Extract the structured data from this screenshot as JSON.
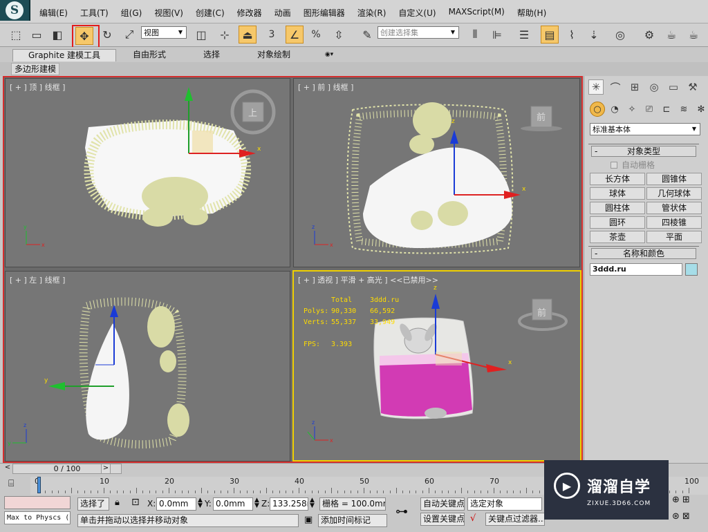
{
  "menubar": {
    "items": [
      "编辑(E)",
      "工具(T)",
      "组(G)",
      "视图(V)",
      "创建(C)",
      "修改器",
      "动画",
      "图形编辑器",
      "渲染(R)",
      "自定义(U)",
      "MAXScript(M)",
      "帮助(H)"
    ]
  },
  "toolbar": {
    "view_dropdown": "视图",
    "selection_set_placeholder": "创建选择集",
    "num_snap": "3",
    "percent": "%"
  },
  "ribbon": {
    "tabs": [
      "Graphite 建模工具",
      "自由形式",
      "选择",
      "对象绘制"
    ],
    "subtab": "多边形建模"
  },
  "viewports": {
    "top": {
      "label": "[ + ] 顶 ] 线框 ]",
      "cube": "上"
    },
    "front": {
      "label": "[ + ] 前 ] 线框 ]",
      "cube": "前"
    },
    "left": {
      "label": "[ + ] 左 ] 线框 ]"
    },
    "persp": {
      "label": "[ + ] 透视 ] 平滑 + 高光 ] <<已禁用>>",
      "cube": "前",
      "stats": {
        "header_total": "Total",
        "header_obj": "3ddd.ru",
        "polys_label": "Polys:",
        "polys_total": "90,330",
        "polys_obj": "66,592",
        "verts_label": "Verts:",
        "verts_total": "55,337",
        "verts_obj": "33,949",
        "fps_label": "FPS:",
        "fps_value": "3.393"
      }
    }
  },
  "command_panel": {
    "category_dropdown": "标准基本体",
    "object_type_header": "对象类型",
    "autogrid_label": "自动栅格",
    "object_buttons": [
      "长方体",
      "圆锥体",
      "球体",
      "几何球体",
      "圆柱体",
      "管状体",
      "圆环",
      "四棱锥",
      "茶壶",
      "平面"
    ],
    "name_color_header": "名称和颜色",
    "object_name": "3ddd.ru",
    "object_color": "#a6dde8"
  },
  "timeline": {
    "slider_label": "0 / 100",
    "ticks": [
      "0",
      "10",
      "20",
      "30",
      "40",
      "50",
      "60",
      "70",
      "80",
      "90",
      "100"
    ]
  },
  "status": {
    "script_text": "Max to Physcs (",
    "selection_info": "选择了",
    "x_label": "X:",
    "x_value": "0.0mm",
    "y_label": "Y:",
    "y_value": "0.0mm",
    "z_label": "Z:",
    "z_value": "133.258mr",
    "grid_text": "栅格 = 100.0mm",
    "prompt_text": "单击并拖动以选择并移动对象",
    "add_time_tag": "添加时间标记",
    "auto_key": "自动关键点",
    "set_key": "设置关键点",
    "selected_objects": "选定对象",
    "key_filters": "关键点过滤器..."
  },
  "watermark": {
    "title": "溜溜自学",
    "subtitle": "ZIXUE.3D66.COM"
  },
  "colors": {
    "active_border": "#d42d2d",
    "active_viewport": "#f0d000",
    "wireframe": "#e8eab8",
    "pillow_pink": "#d23bb4"
  }
}
